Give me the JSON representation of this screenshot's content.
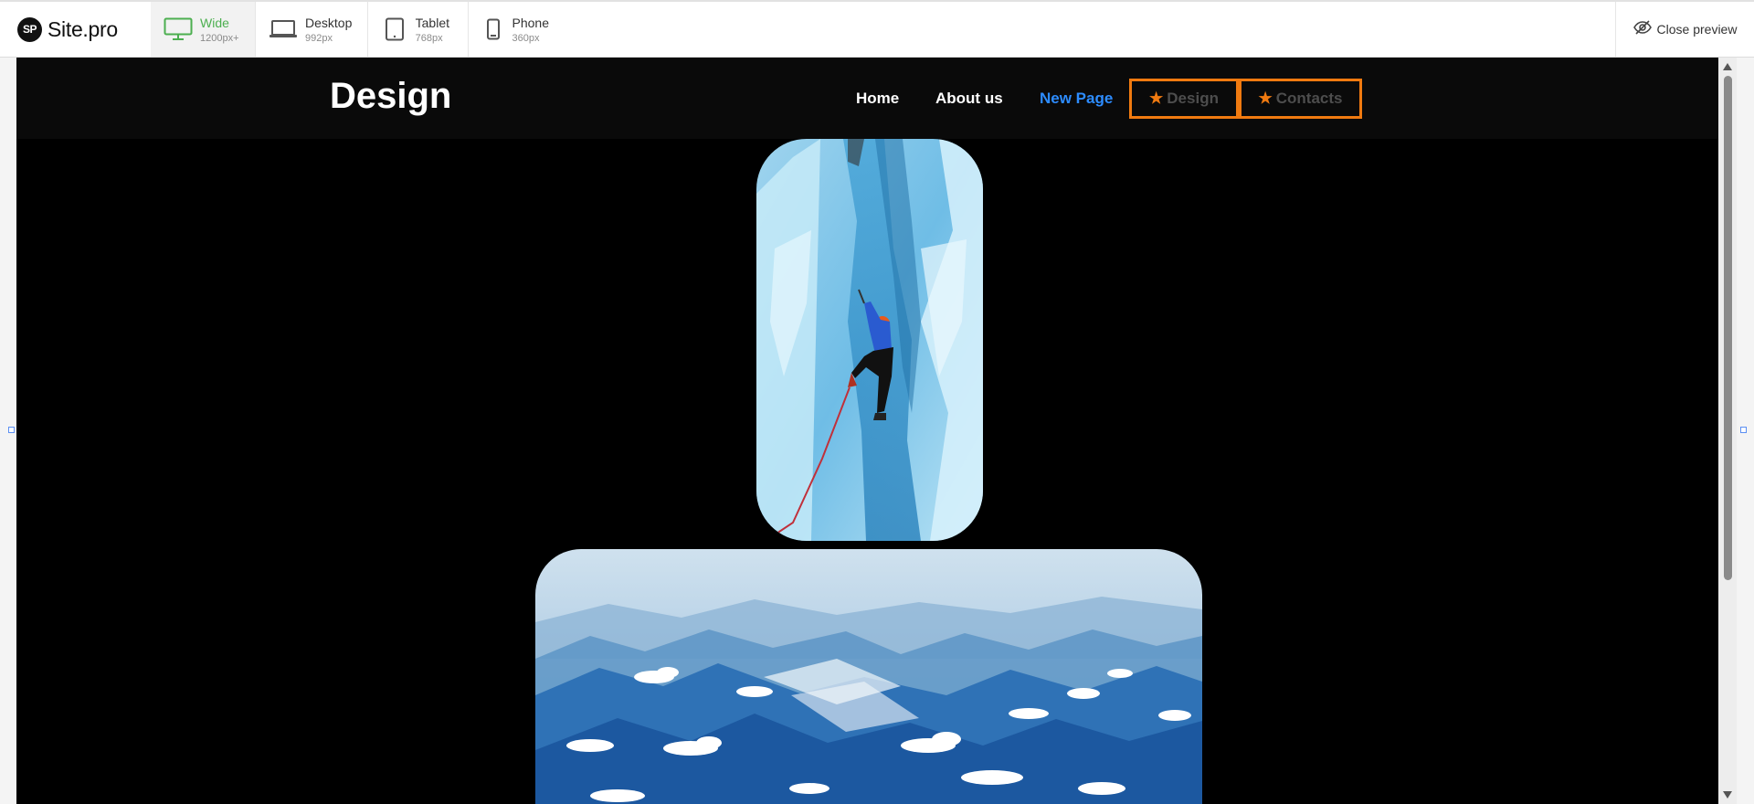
{
  "toolbar": {
    "brand": {
      "logo": "SP",
      "name": "Site.pro"
    },
    "devices": [
      {
        "name": "Wide",
        "size": "1200px+",
        "icon": "monitor-icon",
        "active": true
      },
      {
        "name": "Desktop",
        "size": "992px",
        "icon": "laptop-icon",
        "active": false
      },
      {
        "name": "Tablet",
        "size": "768px",
        "icon": "tablet-icon",
        "active": false
      },
      {
        "name": "Phone",
        "size": "360px",
        "icon": "phone-icon",
        "active": false
      }
    ],
    "close_label": "Close preview"
  },
  "site": {
    "title": "Design",
    "nav": {
      "home": "Home",
      "about": "About us",
      "new_page": "New Page",
      "design": "Design",
      "contacts": "Contacts"
    },
    "images": {
      "ice_climber": "ice-climber-photo",
      "mountains": "mountains-above-clouds-photo"
    }
  },
  "colors": {
    "active_device": "#4caf50",
    "nav_current": "#2d8cff",
    "nav_button_border": "#f07a10",
    "page_background": "#000000"
  }
}
